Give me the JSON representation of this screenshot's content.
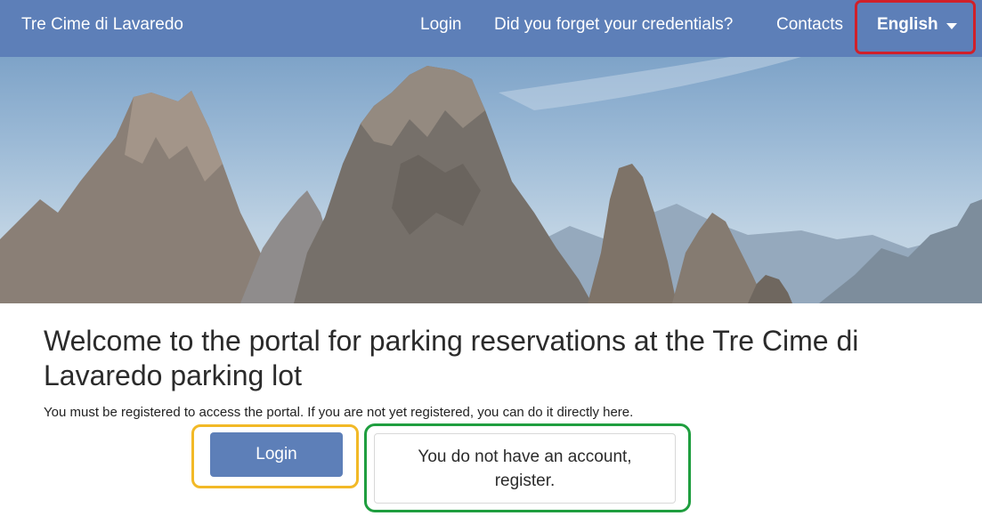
{
  "navbar": {
    "brand": "Tre Cime di Lavaredo",
    "links": {
      "login": "Login",
      "forgot": "Did you forget your credentials?",
      "contacts": "Contacts"
    },
    "language": {
      "label": "English",
      "icon": "caret-down-icon"
    },
    "color": "#5d7fb8"
  },
  "main": {
    "title": "Welcome to the portal for parking reservations at the Tre Cime di Lavaredo parking lot",
    "subtitle": "You must be registered to access the portal. If you are not yet registered, you can do it directly here.",
    "login_button": "Login",
    "register_button": "You do not have an account, register."
  },
  "highlights": {
    "language": "#d0202a",
    "login": "#f2b927",
    "register": "#1f9e3f"
  }
}
